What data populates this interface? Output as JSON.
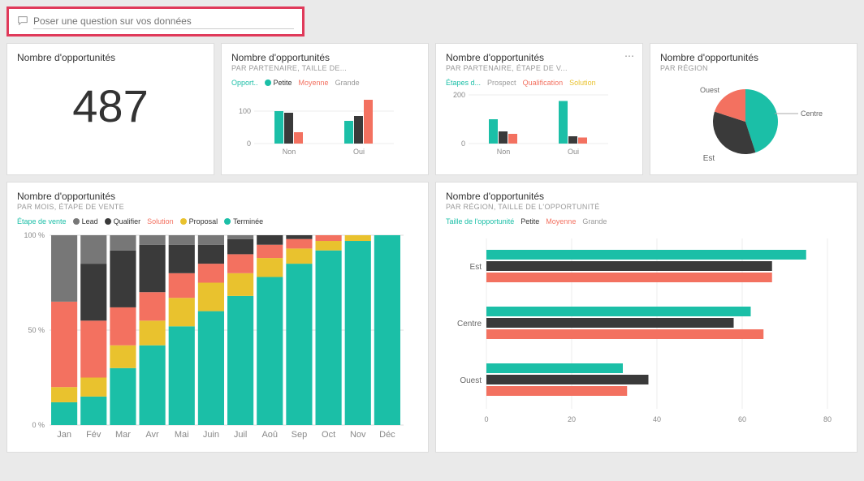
{
  "search": {
    "placeholder": "Poser une question sur vos données"
  },
  "colors": {
    "teal": "#1bbfa7",
    "dark": "#3a3a3a",
    "coral": "#f37160",
    "yellow": "#e9c22e",
    "gray": "#777"
  },
  "tiles": {
    "kpi": {
      "title": "Nombre d'opportunités",
      "value": "487"
    },
    "partnerSize": {
      "title": "Nombre d'opportunités",
      "sub": "PAR PARTENAIRE, TAILLE DE...",
      "legendLabel": "Opport..",
      "legend": [
        "Petite",
        "Moyenne",
        "Grande"
      ]
    },
    "partnerStage": {
      "title": "Nombre d'opportunités",
      "sub": "PAR PARTENAIRE, ÉTAPE DE V...",
      "legendLabel": "Étapes d...",
      "legend": [
        "Prospect",
        "Qualification",
        "Solution"
      ]
    },
    "region": {
      "title": "Nombre d'opportunités",
      "sub": "PAR RÉGION",
      "labels": {
        "ouest": "Ouest",
        "est": "Est",
        "centre": "Centre"
      }
    },
    "monthStage": {
      "title": "Nombre d'opportunités",
      "sub": "PAR MOIS, ÉTAPE DE VENTE",
      "legendLabel": "Étape de vente",
      "legend": [
        "Lead",
        "Qualifier",
        "Solution",
        "Proposal",
        "Terminée"
      ]
    },
    "regionSize": {
      "title": "Nombre d'opportunités",
      "sub": "PAR RÉGION, TAILLE DE L'OPPORTUNITÉ",
      "legendLabel": "Taille de l'opportunité",
      "legend": [
        "Petite",
        "Moyenne",
        "Grande"
      ]
    }
  },
  "chart_data": [
    {
      "id": "kpi",
      "type": "table",
      "title": "Nombre d'opportunités",
      "value": 487
    },
    {
      "id": "partnerSize",
      "type": "bar",
      "title": "Nombre d'opportunités par partenaire, taille",
      "categories": [
        "Non",
        "Oui"
      ],
      "series": [
        {
          "name": "Petite",
          "values": [
            100,
            70
          ]
        },
        {
          "name": "Moyenne",
          "values": [
            95,
            85
          ]
        },
        {
          "name": "Grande",
          "values": [
            35,
            135
          ]
        }
      ],
      "ylim": [
        0,
        150
      ],
      "yticks": [
        0,
        100
      ]
    },
    {
      "id": "partnerStage",
      "type": "bar",
      "title": "Nombre d'opportunités par partenaire, étape de vente",
      "categories": [
        "Non",
        "Oui"
      ],
      "series": [
        {
          "name": "Prospect",
          "values": [
            100,
            175
          ]
        },
        {
          "name": "Qualification",
          "values": [
            50,
            30
          ]
        },
        {
          "name": "Solution",
          "values": [
            40,
            25
          ]
        }
      ],
      "ylim": [
        0,
        200
      ],
      "yticks": [
        0,
        200
      ]
    },
    {
      "id": "region",
      "type": "pie",
      "title": "Nombre d'opportunités par région",
      "slices": [
        {
          "name": "Centre",
          "value": 45
        },
        {
          "name": "Est",
          "value": 35
        },
        {
          "name": "Ouest",
          "value": 20
        }
      ]
    },
    {
      "id": "monthStage",
      "type": "bar",
      "stacked": true,
      "title": "Nombre d'opportunités par mois, étape de vente (100%)",
      "categories": [
        "Jan",
        "Fév",
        "Mar",
        "Avr",
        "Mai",
        "Juin",
        "Juil",
        "Aoû",
        "Sep",
        "Oct",
        "Nov",
        "Déc"
      ],
      "series": [
        {
          "name": "Terminée",
          "values": [
            12,
            15,
            30,
            42,
            52,
            60,
            68,
            78,
            85,
            92,
            97,
            100
          ]
        },
        {
          "name": "Proposal",
          "values": [
            8,
            10,
            12,
            13,
            15,
            15,
            12,
            10,
            8,
            5,
            3,
            0
          ]
        },
        {
          "name": "Solution",
          "values": [
            45,
            30,
            20,
            15,
            13,
            10,
            10,
            7,
            5,
            3,
            0,
            0
          ]
        },
        {
          "name": "Qualifier",
          "values": [
            0,
            30,
            30,
            25,
            15,
            10,
            8,
            5,
            2,
            0,
            0,
            0
          ]
        },
        {
          "name": "Lead",
          "values": [
            35,
            15,
            8,
            5,
            5,
            5,
            2,
            0,
            0,
            0,
            0,
            0
          ]
        }
      ],
      "ylim": [
        0,
        100
      ],
      "ylabel": "%",
      "yticks": [
        0,
        50,
        100
      ]
    },
    {
      "id": "regionSize",
      "type": "bar",
      "orientation": "horizontal",
      "title": "Nombre d'opportunités par région, taille",
      "categories": [
        "Est",
        "Centre",
        "Ouest"
      ],
      "series": [
        {
          "name": "Petite",
          "values": [
            75,
            62,
            32
          ]
        },
        {
          "name": "Moyenne",
          "values": [
            67,
            58,
            38
          ]
        },
        {
          "name": "Grande",
          "values": [
            67,
            65,
            33
          ]
        }
      ],
      "xlim": [
        0,
        80
      ],
      "xticks": [
        0,
        20,
        40,
        60,
        80
      ]
    }
  ]
}
